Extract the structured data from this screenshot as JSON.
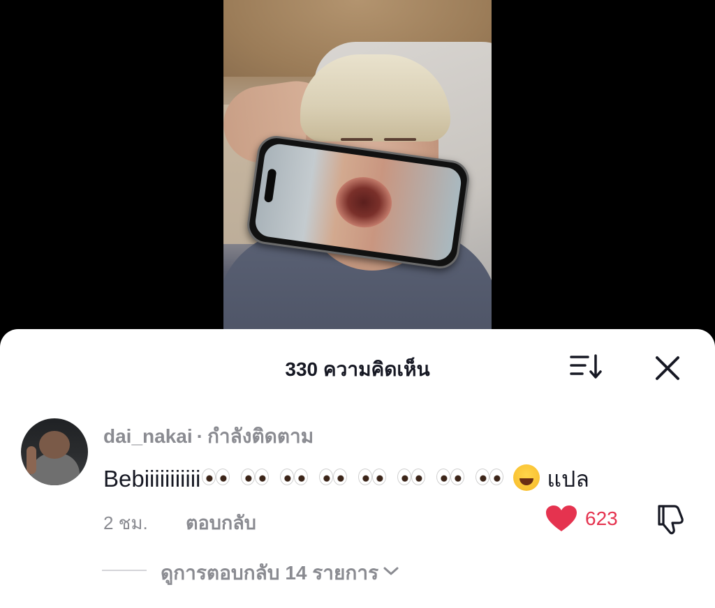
{
  "video": {
    "background_color": "#000000"
  },
  "comments_sheet": {
    "title": "330 ความคิดเห็น",
    "sort_icon": "sort-icon",
    "close_icon": "close-icon"
  },
  "comment": {
    "avatar_icon": "avatar",
    "username": "dai_nakai",
    "separator": "·",
    "follow_status": "กำลังติดตาม",
    "text_main": "Bebiiiiiiiiiii",
    "emoji_eyes_count": 8,
    "text_suffix": "แปล",
    "time": "2 ชม.",
    "reply_label": "ตอบกลับ",
    "like_icon": "heart-icon",
    "like_color": "#e5334f",
    "like_count": "623",
    "dislike_icon": "thumbs-down-icon",
    "view_replies_label": "ดูการตอบกลับ 14 รายการ",
    "view_replies_icon": "chevron-down-icon"
  }
}
